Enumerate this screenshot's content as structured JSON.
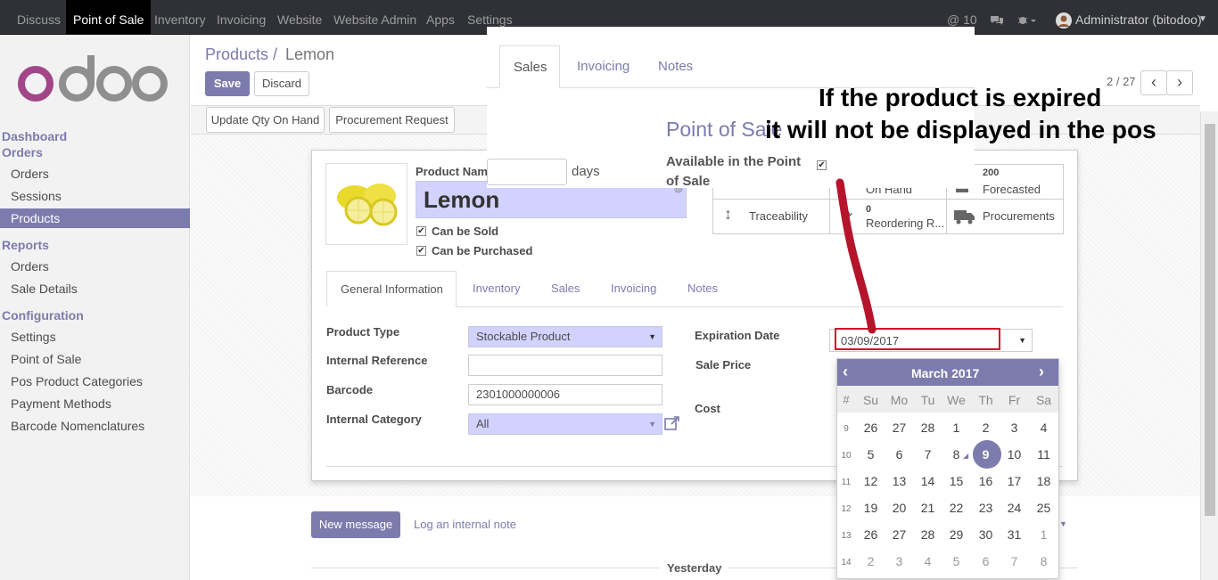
{
  "topbar": {
    "menus": [
      "Discuss",
      "Point of Sale",
      "Inventory",
      "Invoicing",
      "Website",
      "Website Admin",
      "Apps",
      "Settings"
    ],
    "active": "Point of Sale",
    "mentions": "@ 10",
    "user": "Administrator (bitodoo)"
  },
  "logo": "odoo",
  "sidebar": {
    "dashboard": "Dashboard",
    "orders_head": "Orders",
    "orders": "Orders",
    "sessions": "Sessions",
    "products": "Products",
    "reports_head": "Reports",
    "r_orders": "Orders",
    "sale_details": "Sale Details",
    "config_head": "Configuration",
    "settings": "Settings",
    "point_of_sale": "Point of Sale",
    "pos_categories": "Pos Product Categories",
    "payment_methods": "Payment Methods",
    "barcode_nom": "Barcode Nomenclatures"
  },
  "breadcrumb": {
    "parent": "Products /",
    "current": "Lemon"
  },
  "buttons": {
    "save": "Save",
    "discard": "Discard",
    "update_qty": "Update Qty On Hand",
    "procurement": "Procurement Request",
    "pager": "2 / 27"
  },
  "product": {
    "name_label": "Product Nam",
    "name": "Lemon",
    "can_be_sold": "Can be Sold",
    "can_be_purchased": "Can be Purchased"
  },
  "stats": {
    "on_hand": "On Hand",
    "forecast_value": "200",
    "forecasted": "Forecasted",
    "traceability": "Traceability",
    "reorder_value": "0",
    "reordering": "Reordering R...",
    "procurements": "Procurements"
  },
  "tabs": [
    "General Information",
    "Inventory",
    "Sales",
    "Invoicing",
    "Notes"
  ],
  "fields": {
    "product_type_label": "Product Type",
    "product_type": "Stockable Product",
    "internal_ref_label": "Internal Reference",
    "internal_ref": "",
    "barcode_label": "Barcode",
    "barcode": "2301000000006",
    "internal_cat_label": "Internal Category",
    "internal_cat": "All",
    "expiration_label": "Expiration Date",
    "expiration": "03/09/2017",
    "sale_price_label": "Sale Price",
    "cost_label": "Cost"
  },
  "popup": {
    "tabs": [
      "Sales",
      "Invoicing",
      "Notes"
    ],
    "days": "days",
    "section": "Point of Sale",
    "available_label": "Available in the Point of Sale"
  },
  "annotation": {
    "line1": "If the product is expired",
    "line2": "it will not be displayed in the pos"
  },
  "calendar": {
    "month": "March 2017",
    "prev": "‹",
    "next": "›",
    "dow": [
      "#",
      "Su",
      "Mo",
      "Tu",
      "We",
      "Th",
      "Fr",
      "Sa"
    ],
    "weeks": [
      [
        "9",
        "26",
        "27",
        "28",
        "1",
        "2",
        "3",
        "4"
      ],
      [
        "10",
        "5",
        "6",
        "7",
        "8",
        "9",
        "10",
        "11"
      ],
      [
        "11",
        "12",
        "13",
        "14",
        "15",
        "16",
        "17",
        "18"
      ],
      [
        "12",
        "19",
        "20",
        "21",
        "22",
        "23",
        "24",
        "25"
      ],
      [
        "13",
        "26",
        "27",
        "28",
        "29",
        "30",
        "31",
        "1"
      ],
      [
        "14",
        "2",
        "3",
        "4",
        "5",
        "6",
        "7",
        "8"
      ]
    ],
    "selected": "9"
  },
  "chatter": {
    "new_message": "New message",
    "log_note": "Log an internal note",
    "yesterday": "Yesterday"
  },
  "colors": {
    "accent": "#7c7bad",
    "topbar": "#2f3136",
    "required": "#d2d2ff",
    "annotation_line": "#b5142b"
  }
}
